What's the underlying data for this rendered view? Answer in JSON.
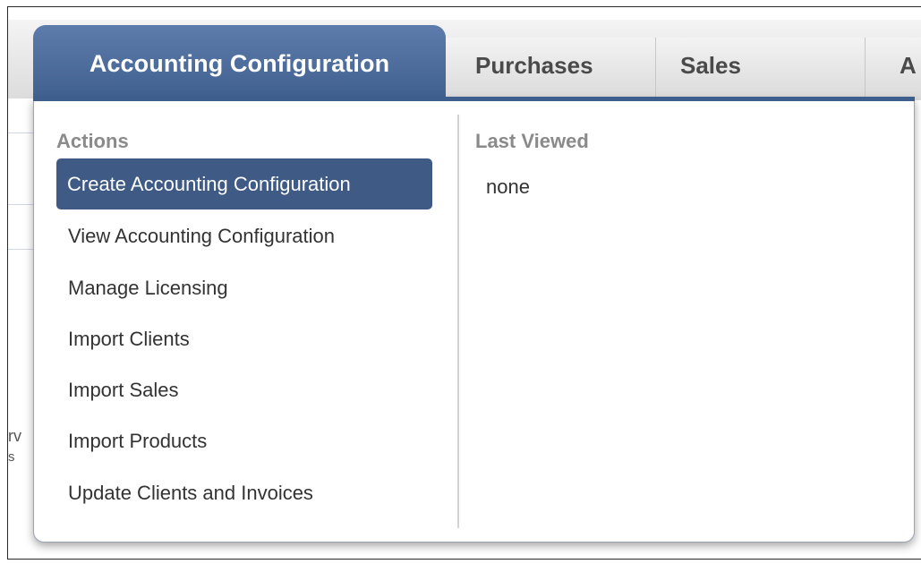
{
  "tabs": {
    "active_label": "Accounting Configuration",
    "purchases_label": "Purchases",
    "sales_label": "Sales",
    "more_label": "A"
  },
  "menu": {
    "actions_heading": "Actions",
    "actions": [
      {
        "label": "Create Accounting Configuration"
      },
      {
        "label": "View Accounting Configuration"
      },
      {
        "label": "Manage Licensing"
      },
      {
        "label": "Import Clients"
      },
      {
        "label": "Import Sales"
      },
      {
        "label": "Import Products"
      },
      {
        "label": "Update Clients and Invoices"
      }
    ],
    "last_viewed_heading": "Last Viewed",
    "last_viewed_value": "none"
  },
  "background": {
    "fragment_1": "rv",
    "fragment_2": "s"
  },
  "colors": {
    "accent": "#3e5e8e",
    "selected_item": "#3e5a85",
    "heading_gray": "#8a8a8a"
  }
}
